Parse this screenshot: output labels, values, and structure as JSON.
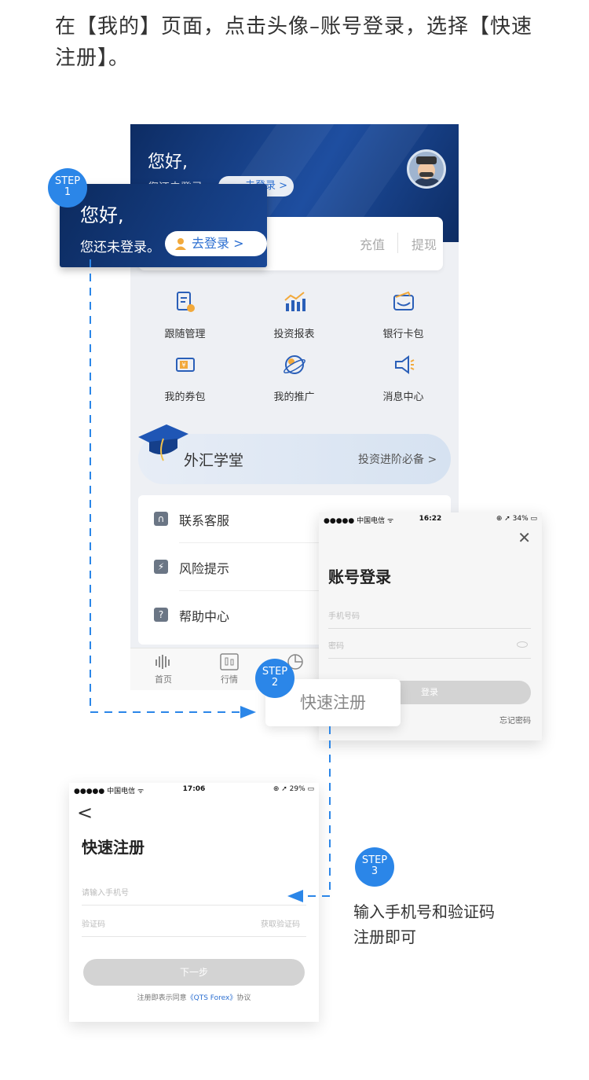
{
  "intro": "在【我的】页面，点击头像–账号登录，选择【快速注册】。",
  "colors": {
    "accent": "#2b86e8",
    "header_dark": "#0d2c63",
    "link": "#2c6fd1"
  },
  "phone1": {
    "greeting": "您好,",
    "sub": "您还未登录",
    "login_pill": "去登录 >",
    "card": {
      "recharge": "充值",
      "withdraw": "提现"
    },
    "grid": [
      {
        "label": "跟随管理",
        "icon": "document-gear-icon"
      },
      {
        "label": "投资报表",
        "icon": "bar-chart-icon"
      },
      {
        "label": "银行卡包",
        "icon": "wallet-icon"
      },
      {
        "label": "我的券包",
        "icon": "coupon-icon"
      },
      {
        "label": "我的推广",
        "icon": "planet-icon"
      },
      {
        "label": "消息中心",
        "icon": "megaphone-icon"
      }
    ],
    "banner": {
      "title": "外汇学堂",
      "sub": "投资进阶必备 >"
    },
    "list": [
      {
        "label": "联系客服",
        "icon": "headset-icon",
        "glyph": "∩"
      },
      {
        "label": "风险提示",
        "icon": "lightning-icon",
        "glyph": "⚡"
      },
      {
        "label": "帮助中心",
        "icon": "question-icon",
        "glyph": "?"
      }
    ],
    "tabs": [
      {
        "label": "首页",
        "icon": "home-icon"
      },
      {
        "label": "行情",
        "icon": "candlestick-icon"
      },
      {
        "label": "",
        "icon": "pie-chart-icon"
      }
    ]
  },
  "step1": {
    "badge_top": "STEP",
    "badge_num": "1",
    "greeting": "您好,",
    "sub": "您还未登录。",
    "pill": "去登录 >"
  },
  "phone2": {
    "status": {
      "carrier": "●●●●● 中国电信 ᯤ",
      "time": "16:22",
      "right": "⊕ ➚ 34% ▭"
    },
    "close": "✕",
    "title": "账号登录",
    "phone_placeholder": "手机号码",
    "password_placeholder": "密码",
    "login_button": "登录",
    "forgot": "忘记密码"
  },
  "step2": {
    "badge_top": "STEP",
    "badge_num": "2",
    "label": "快速注册"
  },
  "phone3": {
    "status": {
      "carrier": "●●●●● 中国电信 ᯤ",
      "time": "17:06",
      "right": "⊕ ➚ 29% ▭"
    },
    "back": "<",
    "title": "快速注册",
    "phone_placeholder": "请输入手机号",
    "code_placeholder": "验证码",
    "get_code": "获取验证码",
    "next_button": "下一步",
    "agree_prefix": "注册即表示同意",
    "agree_link": "《QTS Forex》",
    "agree_suffix": "协议"
  },
  "step3": {
    "badge_top": "STEP",
    "badge_num": "3",
    "text": "输入手机号和验证码\n注册即可"
  }
}
